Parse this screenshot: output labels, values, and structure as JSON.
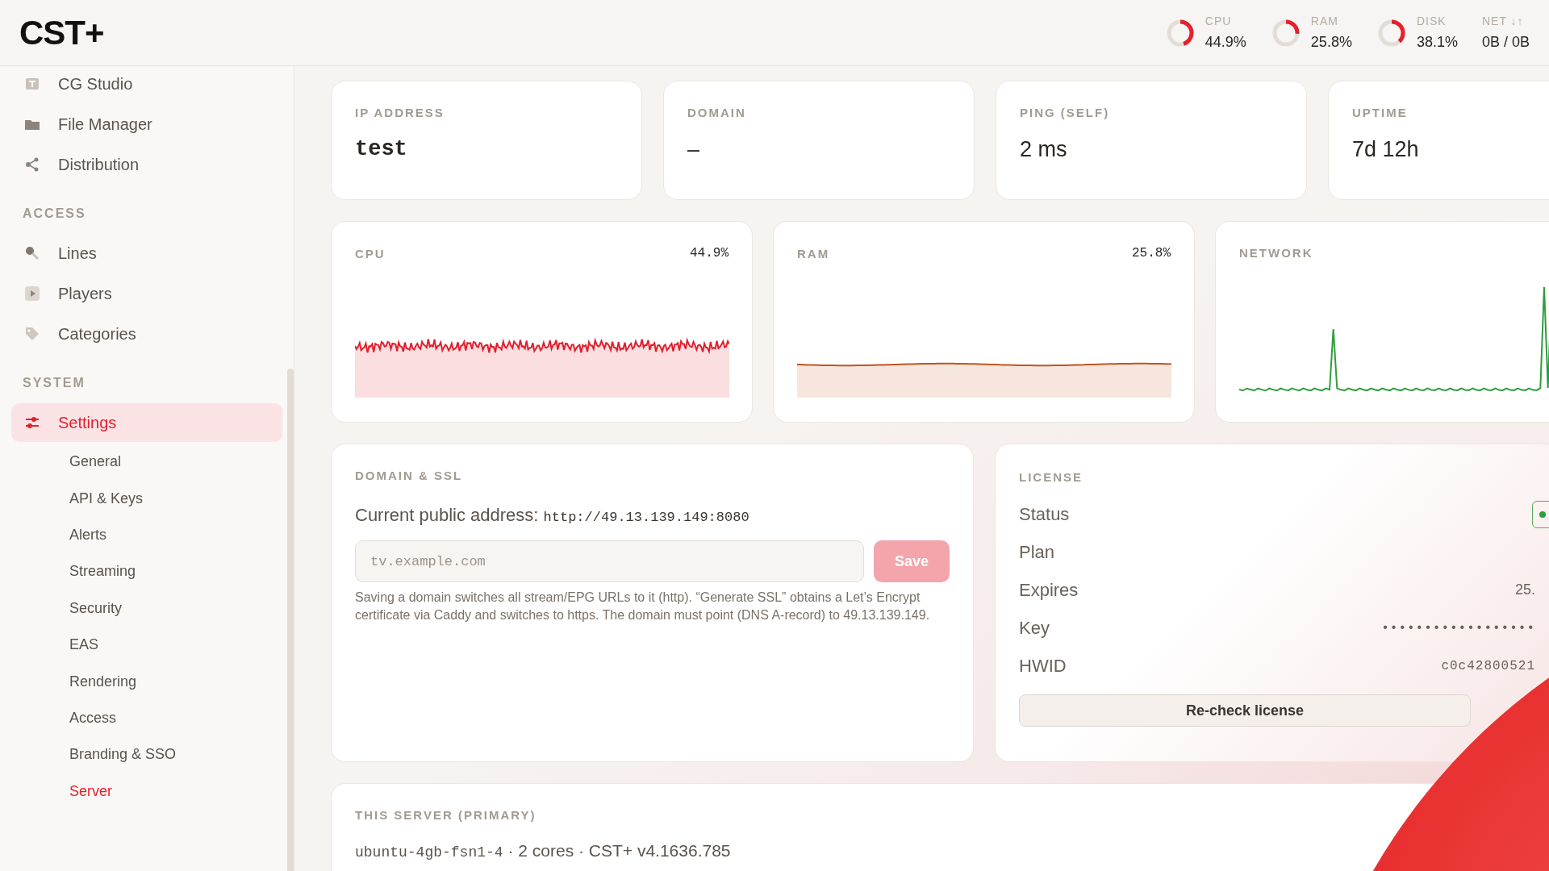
{
  "header": {
    "logo": "CST+",
    "meters": [
      {
        "label": "CPU",
        "value": "44.9%",
        "level": 0.449
      },
      {
        "label": "RAM",
        "value": "25.8%",
        "level": 0.258
      },
      {
        "label": "DISK",
        "value": "38.1%",
        "level": 0.381
      }
    ],
    "net": {
      "label": "NET ↓↑",
      "value": "0B / 0B"
    }
  },
  "sidebar": {
    "groups": [
      {
        "items": [
          {
            "label": "CG Studio",
            "selected": false
          },
          {
            "label": "File Manager",
            "selected": false
          },
          {
            "label": "Distribution",
            "selected": false
          }
        ]
      },
      {
        "heading": "ACCESS",
        "items": [
          {
            "label": "Lines",
            "selected": false
          },
          {
            "label": "Players",
            "selected": false
          },
          {
            "label": "Categories",
            "selected": false
          }
        ]
      },
      {
        "heading": "SYSTEM",
        "items": [
          {
            "label": "Settings",
            "selected": true,
            "children": [
              {
                "label": "General",
                "selected": false
              },
              {
                "label": "API & Keys",
                "selected": false
              },
              {
                "label": "Alerts",
                "selected": false
              },
              {
                "label": "Streaming",
                "selected": false
              },
              {
                "label": "Security",
                "selected": false
              },
              {
                "label": "EAS",
                "selected": false
              },
              {
                "label": "Rendering",
                "selected": false
              },
              {
                "label": "Access",
                "selected": false
              },
              {
                "label": "Branding & SSO",
                "selected": false
              },
              {
                "label": "Server",
                "selected": true
              }
            ]
          }
        ]
      }
    ]
  },
  "stats": [
    {
      "label": "IP ADDRESS",
      "value": "test",
      "kind": "mono"
    },
    {
      "label": "DOMAIN",
      "value": "–",
      "kind": "text"
    },
    {
      "label": "PING (SELF)",
      "value": "2 ms",
      "kind": "text"
    },
    {
      "label": "UPTIME",
      "value": "7d 12h",
      "kind": "text"
    }
  ],
  "charts": [
    {
      "title": "CPU",
      "reading": "44.9%",
      "kind": "noisy",
      "color": "#e0202e"
    },
    {
      "title": "RAM",
      "reading": "25.8%",
      "kind": "flat",
      "color": "#c0541e"
    },
    {
      "title": "NETWORK",
      "kind": "spikes",
      "color": "#2e9e3e"
    }
  ],
  "domain_ssl": {
    "title": "DOMAIN & SSL",
    "address_label": "Current public address:",
    "address": "http://49.13.139.149:8080",
    "placeholder": "tv.example.com",
    "save_button": "Save",
    "save_disabled": true,
    "help": "Saving a domain switches all stream/EPG URLs to it (http). “Generate SSL” obtains a Let’s Encrypt certificate via Caddy and switches to https. The domain must point (DNS A-record) to 49.13.139.149."
  },
  "license": {
    "title": "LICENSE",
    "status_ok": true,
    "rows": [
      {
        "label": "Status",
        "kind": "status"
      },
      {
        "label": "Plan",
        "kind": "text"
      },
      {
        "label": "Expires",
        "kind": "text",
        "value": "25."
      },
      {
        "label": "Key",
        "kind": "mono",
        "value": "••••••••••••••••••"
      },
      {
        "label": "HWID",
        "kind": "mono",
        "value": "c0c42800521"
      }
    ],
    "button": "Re-check license"
  },
  "server": {
    "title": "THIS SERVER (PRIMARY)",
    "hostname": "ubuntu-4gb-fsn1-4",
    "details": " · 2 cores · CST+ v4.1636.785"
  }
}
